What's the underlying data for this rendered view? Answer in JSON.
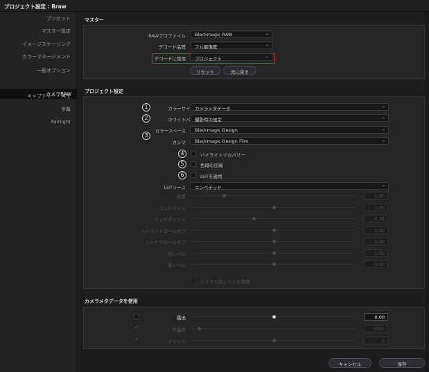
{
  "window": {
    "title": "プロジェクト設定 : Braw"
  },
  "sidebar": {
    "items": [
      {
        "label": "プリセット"
      },
      {
        "label": "マスター設定"
      },
      {
        "label": "イメージスケーリング"
      },
      {
        "label": "カラーマネージメント"
      },
      {
        "label": "一般オプション"
      },
      {
        "label": "カメラRAW"
      },
      {
        "label": "キャプチャー・再生"
      },
      {
        "label": "字幕"
      },
      {
        "label": "Fairlight"
      }
    ],
    "active": "カメラRAW"
  },
  "master": {
    "title": "マスター",
    "raw_profile": {
      "label": "RAWプロファイル",
      "value": "Blackmagic RAW"
    },
    "decode_quality": {
      "label": "デコード品質",
      "value": "フル解像度"
    },
    "decode_using": {
      "label": "デコードに使用",
      "value": "プロジェクト"
    },
    "reset_label": "リセット",
    "undo_label": "元に戻す"
  },
  "project": {
    "title": "プロジェクト設定",
    "markers": [
      "1",
      "2",
      "3",
      "4",
      "5",
      "6"
    ],
    "color_science": {
      "label": "カラーサイエンス",
      "value": "カメラメタデータ"
    },
    "white_balance": {
      "label": "ホワイトバランス",
      "value": "撮影時の設定"
    },
    "color_space": {
      "label": "カラースペース",
      "value": "Blackmagic Design"
    },
    "gamma": {
      "label": "ガンマ",
      "value": "Blackmagic Design Film"
    },
    "highlight_recovery": {
      "label": "ハイライトリカバリー",
      "checked": false
    },
    "gamut_compression": {
      "label": "色域の圧縮",
      "checked": false
    },
    "apply_lut": {
      "label": "LUTを適用",
      "checked": false
    },
    "lut_source": {
      "label": "LUTソース",
      "value": "エンベデッド"
    },
    "sliders": [
      {
        "label": "彩度",
        "value": "1.00",
        "level": 0.2
      },
      {
        "label": "コントラスト",
        "value": "1.00",
        "level": 0.5
      },
      {
        "label": "ミッドポイント",
        "value": "0.38",
        "level": 0.38
      },
      {
        "label": "ハイライトロールオフ",
        "value": "1.00",
        "level": 0.5
      },
      {
        "label": "シャドウロールオフ",
        "value": "1.00",
        "level": 0.5
      },
      {
        "label": "白レベル",
        "value": "1.00",
        "level": 0.5
      },
      {
        "label": "黒レベル",
        "value": "0.00",
        "level": 0.5
      }
    ],
    "video_black_level": {
      "label": "ビデオの黒レベルを使用"
    }
  },
  "metadata": {
    "title": "カメラメタデータを使用",
    "rows": [
      {
        "label": "露出",
        "value": "0.00",
        "level": 0.5,
        "enabled": true
      },
      {
        "label": "色温度",
        "value": "5500",
        "level": 0.05,
        "enabled": false
      },
      {
        "label": "ティント",
        "value": "0",
        "level": 0.5,
        "enabled": false
      }
    ]
  },
  "footer": {
    "cancel_label": "キャンセル",
    "save_label": "保存"
  },
  "colors": {
    "highlight": "#cc2a2a",
    "background": "#1d1d20",
    "panel": "#252528"
  }
}
